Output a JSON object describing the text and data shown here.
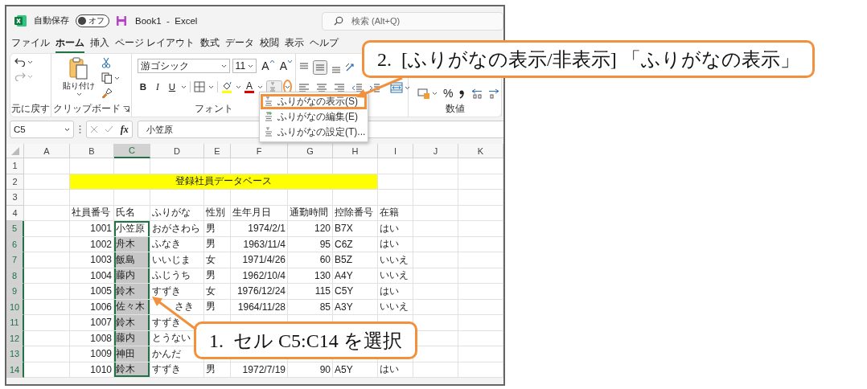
{
  "window": {
    "autosave_label": "自動保存",
    "autosave": {
      "label": "オフ",
      "on": false
    },
    "title": "Book1  -  Excel",
    "search_placeholder": "検索 (Alt+Q)"
  },
  "tabs": [
    {
      "label": "ファイル",
      "selected": false
    },
    {
      "label": "ホーム",
      "selected": true
    },
    {
      "label": "挿入",
      "selected": false
    },
    {
      "label": "ページ レイアウト",
      "selected": false
    },
    {
      "label": "数式",
      "selected": false
    },
    {
      "label": "データ",
      "selected": false
    },
    {
      "label": "校閲",
      "selected": false
    },
    {
      "label": "表示",
      "selected": false
    },
    {
      "label": "ヘルプ",
      "selected": false
    }
  ],
  "ribbon": {
    "undo": {
      "group": "元に戻す"
    },
    "clipboard": {
      "paste_label": "貼り付け",
      "group": "クリップボード"
    },
    "font": {
      "name": "游ゴシック",
      "size": "11",
      "grow": "A",
      "shrink": "A",
      "styles": [
        "B",
        "I",
        "U"
      ],
      "color_letter": "A",
      "furigana_caret_circled": true,
      "group": "フォント"
    },
    "number": {
      "percent": "%",
      "group": "数値"
    }
  },
  "furigana_menu": [
    {
      "label": "ふりがなの表示(S)",
      "highlighted": true
    },
    {
      "label": "ふりがなの編集(E)",
      "highlighted": false
    },
    {
      "label": "ふりがなの設定(T)...",
      "highlighted": false
    }
  ],
  "formula_bar": {
    "name_box": "C5",
    "fx": "fx",
    "formula": "小笠原"
  },
  "sheet": {
    "columns": [
      {
        "label": "A",
        "selected": false
      },
      {
        "label": "B",
        "selected": false
      },
      {
        "label": "C",
        "selected": true
      },
      {
        "label": "D",
        "selected": false
      },
      {
        "label": "E",
        "selected": false
      },
      {
        "label": "F",
        "selected": false
      },
      {
        "label": "G",
        "selected": false
      },
      {
        "label": "H",
        "selected": false
      },
      {
        "label": "I",
        "selected": false
      },
      {
        "label": "J",
        "selected": false
      },
      {
        "label": "K",
        "selected": false
      }
    ],
    "rows": [
      {
        "number": "1",
        "selected": false
      },
      {
        "number": "2",
        "selected": false,
        "cells": [
          {
            "text": "登録社員データベース",
            "kind": "banner",
            "color": "#ffff00",
            "selected": false,
            "active": false
          }
        ]
      },
      {
        "number": "3",
        "selected": false
      },
      {
        "number": "4",
        "selected": false,
        "cells": [
          {
            "text": "社員番号",
            "kind": "text",
            "selected": false,
            "active": false
          },
          {
            "text": "氏名",
            "kind": "text",
            "selected": false,
            "active": false
          },
          {
            "text": "ふりがな",
            "kind": "text",
            "selected": false,
            "active": false
          },
          {
            "text": "性別",
            "kind": "text",
            "selected": false,
            "active": false
          },
          {
            "text": "生年月日",
            "kind": "text",
            "selected": false,
            "active": false
          },
          {
            "text": "通勤時間",
            "kind": "text",
            "selected": false,
            "active": false
          },
          {
            "text": "控除番号",
            "kind": "text",
            "selected": false,
            "active": false
          },
          {
            "text": "在籍",
            "kind": "text",
            "selected": false,
            "active": false
          }
        ]
      },
      {
        "number": "5",
        "selected": true,
        "cells": [
          {
            "text": "1001",
            "kind": "number",
            "selected": false,
            "active": false
          },
          {
            "text": "小笠原",
            "kind": "text",
            "selected": true,
            "active": true
          },
          {
            "text": "おがさわら",
            "kind": "text",
            "selected": false,
            "active": false
          },
          {
            "text": "男",
            "kind": "text",
            "selected": false,
            "active": false
          },
          {
            "text": "1974/2/1",
            "kind": "number",
            "selected": false,
            "active": false
          },
          {
            "text": "120",
            "kind": "number",
            "selected": false,
            "active": false
          },
          {
            "text": "B7X",
            "kind": "text",
            "selected": false,
            "active": false
          },
          {
            "text": "はい",
            "kind": "text",
            "selected": false,
            "active": false
          }
        ]
      },
      {
        "number": "6",
        "selected": true,
        "cells": [
          {
            "text": "1002",
            "kind": "number",
            "selected": false,
            "active": false
          },
          {
            "text": "舟木",
            "kind": "text",
            "selected": true,
            "active": false
          },
          {
            "text": "ふなき",
            "kind": "text",
            "selected": false,
            "active": false
          },
          {
            "text": "男",
            "kind": "text",
            "selected": false,
            "active": false
          },
          {
            "text": "1963/11/4",
            "kind": "number",
            "selected": false,
            "active": false
          },
          {
            "text": "95",
            "kind": "number",
            "selected": false,
            "active": false
          },
          {
            "text": "C6Z",
            "kind": "text",
            "selected": false,
            "active": false
          },
          {
            "text": "はい",
            "kind": "text",
            "selected": false,
            "active": false
          }
        ]
      },
      {
        "number": "7",
        "selected": true,
        "cells": [
          {
            "text": "1003",
            "kind": "number",
            "selected": false,
            "active": false
          },
          {
            "text": "飯島",
            "kind": "text",
            "selected": true,
            "active": false
          },
          {
            "text": "いいじま",
            "kind": "text",
            "selected": false,
            "active": false
          },
          {
            "text": "女",
            "kind": "text",
            "selected": false,
            "active": false
          },
          {
            "text": "1971/4/26",
            "kind": "number",
            "selected": false,
            "active": false
          },
          {
            "text": "60",
            "kind": "number",
            "selected": false,
            "active": false
          },
          {
            "text": "B5Z",
            "kind": "text",
            "selected": false,
            "active": false
          },
          {
            "text": "いいえ",
            "kind": "text",
            "selected": false,
            "active": false
          }
        ]
      },
      {
        "number": "8",
        "selected": true,
        "cells": [
          {
            "text": "1004",
            "kind": "number",
            "selected": false,
            "active": false
          },
          {
            "text": "藤内",
            "kind": "text",
            "selected": true,
            "active": false
          },
          {
            "text": "ふじうち",
            "kind": "text",
            "selected": false,
            "active": false
          },
          {
            "text": "男",
            "kind": "text",
            "selected": false,
            "active": false
          },
          {
            "text": "1962/10/4",
            "kind": "number",
            "selected": false,
            "active": false
          },
          {
            "text": "130",
            "kind": "number",
            "selected": false,
            "active": false
          },
          {
            "text": "A4Y",
            "kind": "text",
            "selected": false,
            "active": false
          },
          {
            "text": "いいえ",
            "kind": "text",
            "selected": false,
            "active": false
          }
        ]
      },
      {
        "number": "9",
        "selected": true,
        "cells": [
          {
            "text": "1005",
            "kind": "number",
            "selected": false,
            "active": false
          },
          {
            "text": "鈴木",
            "kind": "text",
            "selected": true,
            "active": false
          },
          {
            "text": "すずき",
            "kind": "text",
            "selected": false,
            "active": false
          },
          {
            "text": "女",
            "kind": "text",
            "selected": false,
            "active": false
          },
          {
            "text": "1976/12/24",
            "kind": "number",
            "selected": false,
            "active": false
          },
          {
            "text": "115",
            "kind": "number",
            "selected": false,
            "active": false
          },
          {
            "text": "C5Y",
            "kind": "text",
            "selected": false,
            "active": false
          },
          {
            "text": "はい",
            "kind": "text",
            "selected": false,
            "active": false
          }
        ]
      },
      {
        "number": "10",
        "selected": true,
        "cells": [
          {
            "text": "1006",
            "kind": "number",
            "selected": false,
            "active": false
          },
          {
            "text": "佐々木",
            "kind": "text",
            "selected": true,
            "active": false
          },
          {
            "text": "さき",
            "kind": "partly_covered",
            "selected": false,
            "active": false
          },
          {
            "text": "男",
            "kind": "text",
            "selected": false,
            "active": false
          },
          {
            "text": "1964/11/28",
            "kind": "number",
            "selected": false,
            "active": false
          },
          {
            "text": "85",
            "kind": "number",
            "selected": false,
            "active": false
          },
          {
            "text": "A3Y",
            "kind": "text",
            "selected": false,
            "active": false
          },
          {
            "text": "いいえ",
            "kind": "text",
            "selected": false,
            "active": false
          }
        ]
      },
      {
        "number": "11",
        "selected": true,
        "cells": [
          {
            "text": "1007",
            "kind": "number",
            "selected": false,
            "active": false
          },
          {
            "text": "鈴木",
            "kind": "text",
            "selected": true,
            "active": false
          },
          {
            "text": "すずき",
            "kind": "text",
            "selected": false,
            "active": false
          }
        ]
      },
      {
        "number": "12",
        "selected": true,
        "cells": [
          {
            "text": "1008",
            "kind": "number",
            "selected": false,
            "active": false
          },
          {
            "text": "藤内",
            "kind": "text",
            "selected": true,
            "active": false
          },
          {
            "text": "とうない",
            "kind": "text",
            "selected": false,
            "active": false
          }
        ]
      },
      {
        "number": "13",
        "selected": true,
        "cells": [
          {
            "text": "1009",
            "kind": "number",
            "selected": false,
            "active": false
          },
          {
            "text": "神田",
            "kind": "text",
            "selected": true,
            "active": false
          },
          {
            "text": "かんだ",
            "kind": "text",
            "selected": false,
            "active": false
          }
        ]
      },
      {
        "number": "14",
        "selected": true,
        "cells": [
          {
            "text": "1010",
            "kind": "number",
            "selected": false,
            "active": false
          },
          {
            "text": "鈴木",
            "kind": "text",
            "selected": true,
            "active": false
          },
          {
            "text": "すずき",
            "kind": "text",
            "selected": false,
            "active": false
          },
          {
            "text": "男",
            "kind": "text",
            "selected": false,
            "active": false
          },
          {
            "text": "1972/7/19",
            "kind": "number",
            "selected": false,
            "active": false
          },
          {
            "text": "90",
            "kind": "number",
            "selected": false,
            "active": false
          },
          {
            "text": "A5Y",
            "kind": "text",
            "selected": false,
            "active": false
          },
          {
            "text": "はい",
            "kind": "text",
            "selected": false,
            "active": false
          }
        ]
      }
    ]
  },
  "callouts": [
    {
      "text": "2.  [ふりがなの表示/非表示] 「ふりがなの表示」"
    },
    {
      "text": "1.  セル C5:C14 を選択"
    }
  ]
}
